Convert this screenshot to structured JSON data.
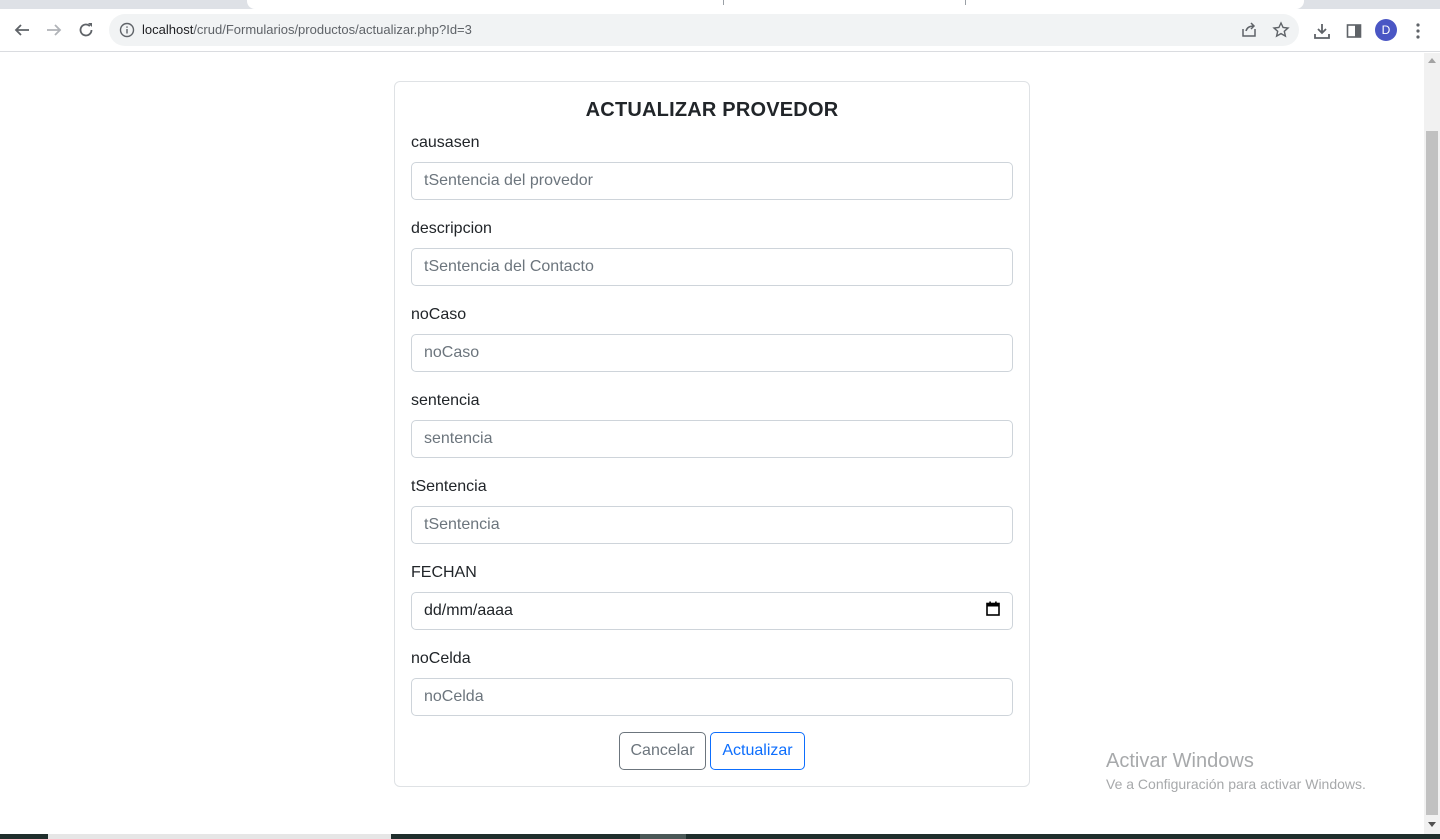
{
  "browser": {
    "url_host": "localhost",
    "url_path": "/crud/Formularios/productos/actualizar.php?Id=3",
    "avatar_letter": "D"
  },
  "form": {
    "title": "ACTUALIZAR PROVEDOR",
    "fields": [
      {
        "label": "causasen",
        "placeholder": "tSentencia del provedor"
      },
      {
        "label": "descripcion",
        "placeholder": "tSentencia del Contacto"
      },
      {
        "label": "noCaso",
        "placeholder": "noCaso"
      },
      {
        "label": "sentencia",
        "placeholder": "sentencia"
      },
      {
        "label": "tSentencia",
        "placeholder": "tSentencia"
      },
      {
        "label": "FECHAN",
        "value": "dd/mm/aaaa"
      },
      {
        "label": "noCelda",
        "placeholder": "noCelda"
      }
    ],
    "cancel_label": "Cancelar",
    "submit_label": "Actualizar"
  },
  "watermark": {
    "title": "Activar Windows",
    "subtitle": "Ve a Configuración para activar Windows."
  },
  "colors": {
    "primary": "#0d6efd",
    "secondary": "#6c757d",
    "avatar": "#4a56c4"
  }
}
